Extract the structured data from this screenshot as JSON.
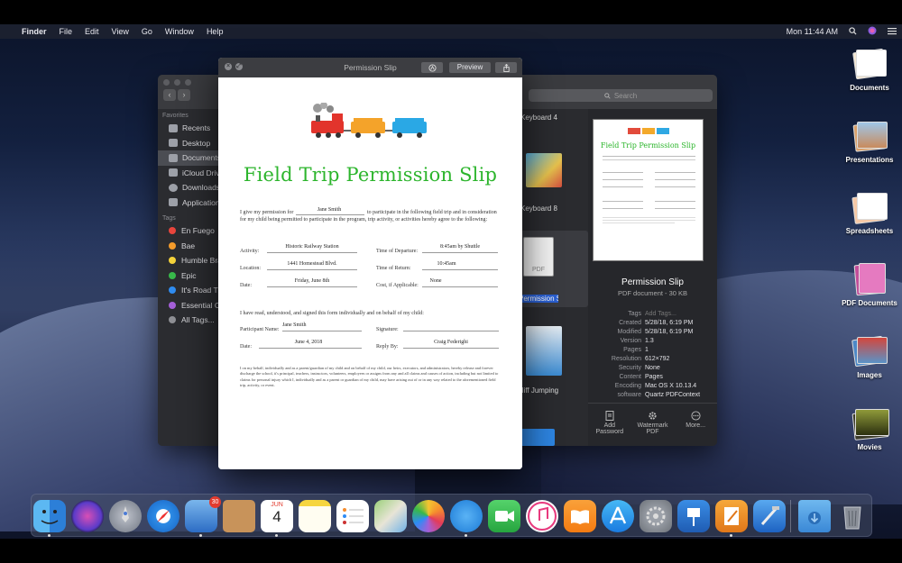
{
  "menubar": {
    "apple": "",
    "app": "Finder",
    "menus": [
      "File",
      "Edit",
      "View",
      "Go",
      "Window",
      "Help"
    ],
    "clock": "Mon 11:44 AM"
  },
  "desktop": {
    "icons": [
      {
        "label": "Documents",
        "icon": "documents-stack-icon"
      },
      {
        "label": "Presentations",
        "icon": "presentations-stack-icon"
      },
      {
        "label": "Spreadsheets",
        "icon": "spreadsheets-stack-icon"
      },
      {
        "label": "PDF Documents",
        "icon": "pdf-stack-icon"
      },
      {
        "label": "Images",
        "icon": "images-stack-icon"
      },
      {
        "label": "Movies",
        "icon": "movies-stack-icon"
      }
    ]
  },
  "finder": {
    "search_placeholder": "Search",
    "sidebar": {
      "favorites_header": "Favorites",
      "favorites": [
        "Recents",
        "Desktop",
        "Documents",
        "iCloud Drive",
        "Downloads",
        "Applications"
      ],
      "tags_header": "Tags",
      "tags": [
        {
          "label": "En Fuego",
          "color": "#e8453c"
        },
        {
          "label": "Bae",
          "color": "#f39b2b"
        },
        {
          "label": "Humble Brag",
          "color": "#f4d23a"
        },
        {
          "label": "Epic",
          "color": "#38b94a"
        },
        {
          "label": "It's Road Trip",
          "color": "#2f8cf0"
        },
        {
          "label": "Essential Content",
          "color": "#a45fd8"
        },
        {
          "label": "All Tags...",
          "color": "#8e8f94"
        }
      ]
    },
    "files": [
      "Keyboard 4",
      "Keyboard 8",
      "Permission Slip",
      "Cliff Jumping"
    ],
    "preview": {
      "doc_title": "Field Trip Permission Slip",
      "name": "Permission Slip",
      "kind": "PDF document - 30 KB",
      "metadata": [
        {
          "k": "Tags",
          "v": "Add Tags..."
        },
        {
          "k": "Created",
          "v": "5/28/18, 6:19 PM"
        },
        {
          "k": "Modified",
          "v": "5/28/18, 6:19 PM"
        },
        {
          "k": "Version",
          "v": "1.3"
        },
        {
          "k": "Pages",
          "v": "1"
        },
        {
          "k": "Resolution",
          "v": "612×792"
        },
        {
          "k": "Security",
          "v": "None"
        },
        {
          "k": "Content",
          "v": "Pages"
        },
        {
          "k": "Encoding",
          "v": "Mac OS X 10.13.4"
        },
        {
          "k": "software",
          "v": "Quartz PDFContext"
        }
      ],
      "actions": [
        "Add Password",
        "Watermark PDF",
        "More..."
      ]
    }
  },
  "preview_window": {
    "title": "Permission Slip",
    "preview_button": "Preview",
    "form": {
      "heading": "Field Trip Permission Slip",
      "intro_a": "I give my permission for",
      "child_name": "Jane Smith",
      "intro_b": "to participate in the following field trip and in consideration",
      "intro_c": "for my child being permitted to participate in the program, trip activity, or activities hereby agree to the following:",
      "activity_label": "Activity:",
      "activity": "Historic Railway Station",
      "departure_label": "Time of Departure:",
      "departure": "8:45am by Shuttle",
      "location_label": "Location:",
      "location": "1441 Homestead Blvd.",
      "return_label": "Time of Return:",
      "return_time": "10:45am",
      "date_label": "Date:",
      "date": "Friday, June 8th",
      "cost_label": "Cost, if Applicable:",
      "cost": "None",
      "consent": "I have read, understood, and signed this form individually and on behalf of my child:",
      "participant_label": "Participant Name:",
      "participant": "Jane Smith",
      "signature_label": "Signature:",
      "date2_label": "Date:",
      "date2": "June 4, 2018",
      "reply_label": "Reply By:",
      "reply": "Craig Federighi",
      "release": "I on my behalf, individually and as a parent/guardian of my child and on behalf of my child, our heirs, executors, and administrators, hereby release and forever discharge the school, it's principal, teachers, instructors, volunteers, employees or assigns from any and all claims and causes of action, including but not limited to claims for personal injury which I, individually and as a parent or guardian of my child, may have arising out of or in any way related to the aforementioned field trip, activity, or event."
    }
  },
  "dock": {
    "apps": [
      "Finder",
      "Siri",
      "Launchpad",
      "Safari",
      "Mail",
      "Contacts",
      "Calendar",
      "Notes",
      "Reminders",
      "Maps",
      "Photos",
      "Messages",
      "FaceTime",
      "iTunes",
      "iBooks",
      "App Store",
      "System Preferences",
      "Keynote",
      "Pages",
      "Xcode",
      "Downloads",
      "Trash"
    ],
    "mail_badge": "30",
    "calendar_month": "JUN",
    "calendar_day": "4"
  }
}
